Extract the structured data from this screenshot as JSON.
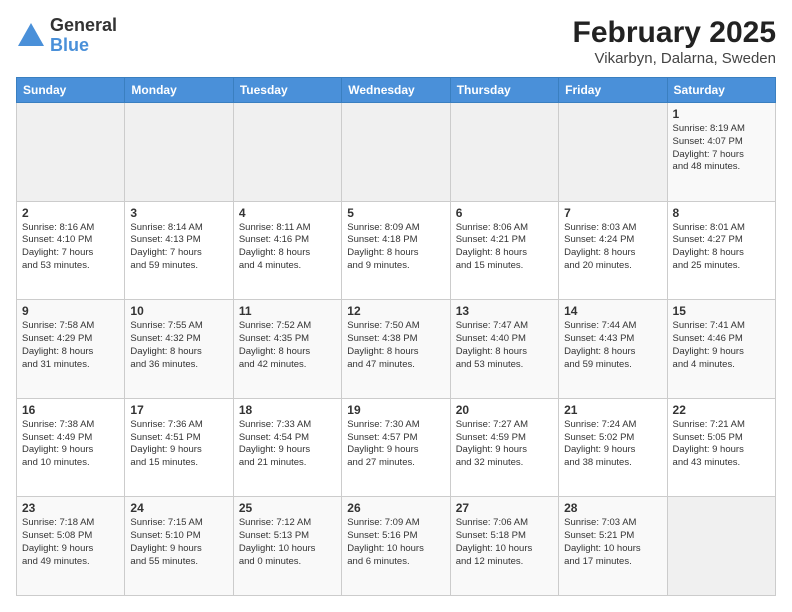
{
  "header": {
    "logo_line1": "General",
    "logo_line2": "Blue",
    "title": "February 2025",
    "subtitle": "Vikarbyn, Dalarna, Sweden"
  },
  "weekdays": [
    "Sunday",
    "Monday",
    "Tuesday",
    "Wednesday",
    "Thursday",
    "Friday",
    "Saturday"
  ],
  "weeks": [
    [
      {
        "day": "",
        "info": ""
      },
      {
        "day": "",
        "info": ""
      },
      {
        "day": "",
        "info": ""
      },
      {
        "day": "",
        "info": ""
      },
      {
        "day": "",
        "info": ""
      },
      {
        "day": "",
        "info": ""
      },
      {
        "day": "1",
        "info": "Sunrise: 8:19 AM\nSunset: 4:07 PM\nDaylight: 7 hours\nand 48 minutes."
      }
    ],
    [
      {
        "day": "2",
        "info": "Sunrise: 8:16 AM\nSunset: 4:10 PM\nDaylight: 7 hours\nand 53 minutes."
      },
      {
        "day": "3",
        "info": "Sunrise: 8:14 AM\nSunset: 4:13 PM\nDaylight: 7 hours\nand 59 minutes."
      },
      {
        "day": "4",
        "info": "Sunrise: 8:11 AM\nSunset: 4:16 PM\nDaylight: 8 hours\nand 4 minutes."
      },
      {
        "day": "5",
        "info": "Sunrise: 8:09 AM\nSunset: 4:18 PM\nDaylight: 8 hours\nand 9 minutes."
      },
      {
        "day": "6",
        "info": "Sunrise: 8:06 AM\nSunset: 4:21 PM\nDaylight: 8 hours\nand 15 minutes."
      },
      {
        "day": "7",
        "info": "Sunrise: 8:03 AM\nSunset: 4:24 PM\nDaylight: 8 hours\nand 20 minutes."
      },
      {
        "day": "8",
        "info": "Sunrise: 8:01 AM\nSunset: 4:27 PM\nDaylight: 8 hours\nand 25 minutes."
      }
    ],
    [
      {
        "day": "9",
        "info": "Sunrise: 7:58 AM\nSunset: 4:29 PM\nDaylight: 8 hours\nand 31 minutes."
      },
      {
        "day": "10",
        "info": "Sunrise: 7:55 AM\nSunset: 4:32 PM\nDaylight: 8 hours\nand 36 minutes."
      },
      {
        "day": "11",
        "info": "Sunrise: 7:52 AM\nSunset: 4:35 PM\nDaylight: 8 hours\nand 42 minutes."
      },
      {
        "day": "12",
        "info": "Sunrise: 7:50 AM\nSunset: 4:38 PM\nDaylight: 8 hours\nand 47 minutes."
      },
      {
        "day": "13",
        "info": "Sunrise: 7:47 AM\nSunset: 4:40 PM\nDaylight: 8 hours\nand 53 minutes."
      },
      {
        "day": "14",
        "info": "Sunrise: 7:44 AM\nSunset: 4:43 PM\nDaylight: 8 hours\nand 59 minutes."
      },
      {
        "day": "15",
        "info": "Sunrise: 7:41 AM\nSunset: 4:46 PM\nDaylight: 9 hours\nand 4 minutes."
      }
    ],
    [
      {
        "day": "16",
        "info": "Sunrise: 7:38 AM\nSunset: 4:49 PM\nDaylight: 9 hours\nand 10 minutes."
      },
      {
        "day": "17",
        "info": "Sunrise: 7:36 AM\nSunset: 4:51 PM\nDaylight: 9 hours\nand 15 minutes."
      },
      {
        "day": "18",
        "info": "Sunrise: 7:33 AM\nSunset: 4:54 PM\nDaylight: 9 hours\nand 21 minutes."
      },
      {
        "day": "19",
        "info": "Sunrise: 7:30 AM\nSunset: 4:57 PM\nDaylight: 9 hours\nand 27 minutes."
      },
      {
        "day": "20",
        "info": "Sunrise: 7:27 AM\nSunset: 4:59 PM\nDaylight: 9 hours\nand 32 minutes."
      },
      {
        "day": "21",
        "info": "Sunrise: 7:24 AM\nSunset: 5:02 PM\nDaylight: 9 hours\nand 38 minutes."
      },
      {
        "day": "22",
        "info": "Sunrise: 7:21 AM\nSunset: 5:05 PM\nDaylight: 9 hours\nand 43 minutes."
      }
    ],
    [
      {
        "day": "23",
        "info": "Sunrise: 7:18 AM\nSunset: 5:08 PM\nDaylight: 9 hours\nand 49 minutes."
      },
      {
        "day": "24",
        "info": "Sunrise: 7:15 AM\nSunset: 5:10 PM\nDaylight: 9 hours\nand 55 minutes."
      },
      {
        "day": "25",
        "info": "Sunrise: 7:12 AM\nSunset: 5:13 PM\nDaylight: 10 hours\nand 0 minutes."
      },
      {
        "day": "26",
        "info": "Sunrise: 7:09 AM\nSunset: 5:16 PM\nDaylight: 10 hours\nand 6 minutes."
      },
      {
        "day": "27",
        "info": "Sunrise: 7:06 AM\nSunset: 5:18 PM\nDaylight: 10 hours\nand 12 minutes."
      },
      {
        "day": "28",
        "info": "Sunrise: 7:03 AM\nSunset: 5:21 PM\nDaylight: 10 hours\nand 17 minutes."
      },
      {
        "day": "",
        "info": ""
      }
    ]
  ]
}
